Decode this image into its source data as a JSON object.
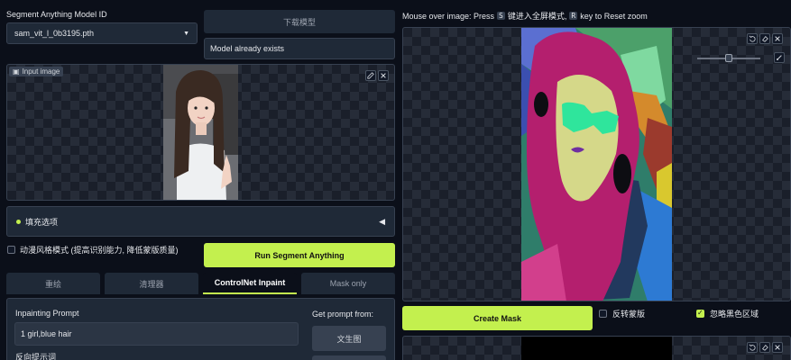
{
  "model": {
    "label": "Segment Anything Model ID",
    "selected": "sam_vit_l_0b3195.pth",
    "download_button": "下载模型",
    "status": "Model already exists"
  },
  "input_image": {
    "label": "Input image"
  },
  "options": {
    "accordion_label": "填充选项",
    "anime_style_label": "动漫风格模式 (提高识别能力, 降低蒙版质量)",
    "anime_style_checked": false
  },
  "run_button": "Run Segment Anything",
  "tabs": [
    {
      "label": "重绘",
      "active": false
    },
    {
      "label": "清理器",
      "active": false
    },
    {
      "label": "ControlNet Inpaint",
      "active": true
    },
    {
      "label": "Mask only",
      "active": false
    }
  ],
  "inpaint": {
    "prompt_label": "Inpainting Prompt",
    "prompt_value": "1 girl,blue hair",
    "negative_label": "反向提示词",
    "get_prompt_label": "Get prompt from:",
    "txt2img_button": "文生图"
  },
  "right": {
    "hint_prefix": "Mouse over image: Press",
    "hint_key1": "S",
    "hint_mid": "键进入全屏模式,",
    "hint_key2": "R",
    "hint_suffix": "key to Reset zoom",
    "create_mask_button": "Create Mask",
    "invert_mask_label": "反转蒙版",
    "invert_mask_checked": false,
    "ignore_black_label": "忽略黑色区域",
    "ignore_black_checked": true
  },
  "colors": {
    "accent": "#c3f04e",
    "background": "#0b0f19",
    "panel": "#1f2937"
  }
}
